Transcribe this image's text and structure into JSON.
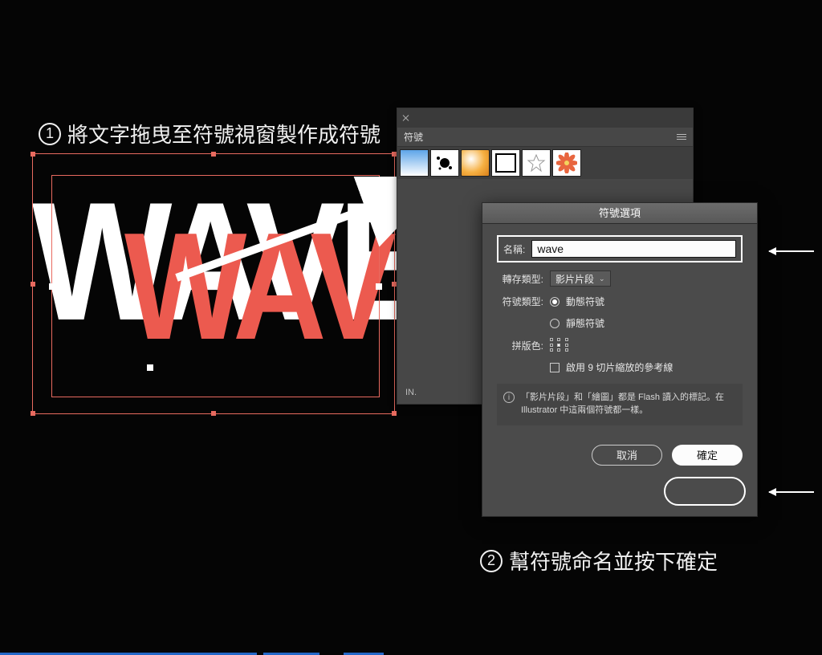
{
  "step1": {
    "num": "1",
    "text": "將文字拖曳至符號視窗製作成符號"
  },
  "step2": {
    "num": "2",
    "text": "幫符號命名並按下確定"
  },
  "artwork": {
    "white": "WAVE",
    "red": "WAVE"
  },
  "symbolsPanel": {
    "tab": "符號",
    "footer": "IN."
  },
  "dialog": {
    "title": "符號選項",
    "nameLabel": "名稱:",
    "nameValue": "wave",
    "exportTypeLabel": "轉存類型:",
    "exportTypeValue": "影片片段",
    "symbolTypeLabel": "符號類型:",
    "radioDynamic": "動態符號",
    "radioStatic": "靜態符號",
    "regLabel": "拼版色:",
    "sliceCheckbox": "啟用 9 切片縮放的參考線",
    "infoText": "「影片片段」和「繪圖」都是 Flash 讀入的標記。在 Illustrator 中這兩個符號都一樣。",
    "cancel": "取消",
    "ok": "確定"
  }
}
